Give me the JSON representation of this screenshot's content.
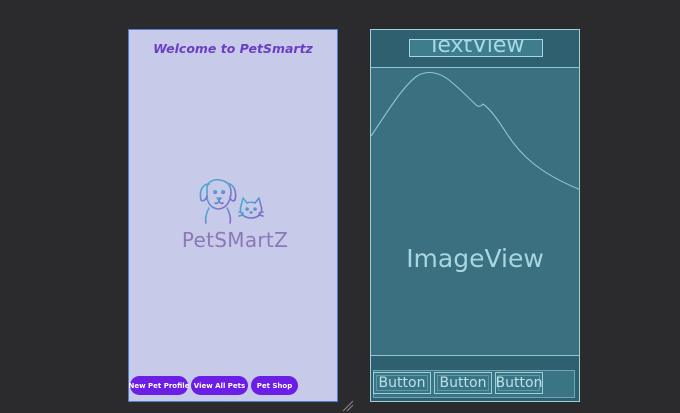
{
  "design_preview": {
    "welcome_text": "Welcome to PetSmartz",
    "logo_text": "PetSMartZ",
    "buttons": [
      {
        "label": "New Pet Profile"
      },
      {
        "label": "View All Pets"
      },
      {
        "label": "Pet Shop"
      }
    ],
    "colors": {
      "background": "#c8cae9",
      "title": "#6a3fc4",
      "button": "#6b1ee6",
      "logo_text": "#8b78b8"
    }
  },
  "blueprint_preview": {
    "textview_label": "TextView",
    "imageview_label": "ImageView",
    "buttons": [
      {
        "label": "Button"
      },
      {
        "label": "Button"
      },
      {
        "label": "Button"
      }
    ],
    "colors": {
      "background": "#3a7080",
      "outline": "#9fd0da"
    }
  },
  "icons": [
    "pet-logo-icon",
    "resize-handle-icon"
  ]
}
